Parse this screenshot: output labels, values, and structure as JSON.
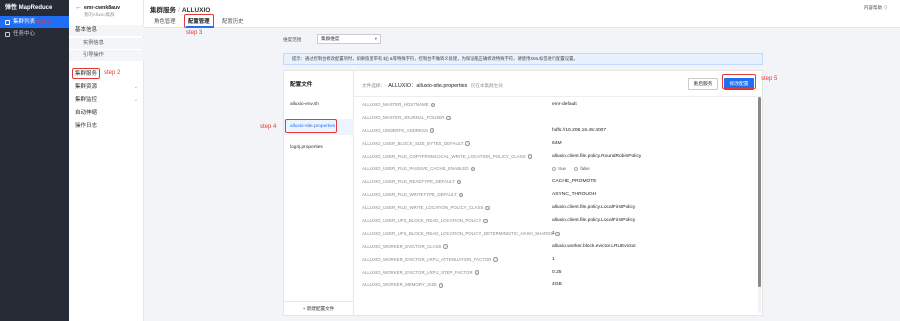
{
  "nav": {
    "brand": "弹性 MapReduce",
    "items": [
      {
        "label": "集群列表",
        "icon": "cluster-icon",
        "active": true,
        "annotation": "step 1"
      },
      {
        "label": "任务中心",
        "icon": "task-icon",
        "active": false
      }
    ]
  },
  "side": {
    "back_icon": "arrow-left-icon",
    "cluster_name": "emr-cwnk8auv",
    "cluster_desc": "我的Alluxio集群",
    "basic_info": "基本信息",
    "basic_sub": [
      "实例信息",
      "引导操作"
    ],
    "items": [
      "集群服务",
      "集群资源",
      "集群监控",
      "自动伸缩",
      "操作日志"
    ]
  },
  "header": {
    "breadcrumb_parent": "集群服务",
    "breadcrumb_sep": "/",
    "breadcrumb_current": "ALLUXIO",
    "help": "内容帮助 ⇩",
    "tabs": [
      "角色管理",
      "配置管理",
      "配置历史"
    ]
  },
  "filter": {
    "label": "维度范围",
    "value": "集群维度"
  },
  "notice": {
    "text": "提示：通过控制台修改配置项时，如果值里带有 ${} &等特殊字符，控制台不做转义处理，为保证能正确修改特殊字符，请使用XML标签进行配置设置。",
    "link": ""
  },
  "filelist": {
    "title": "配置文件",
    "files": [
      "alluxio-env.sh",
      "alluxio-site.properties",
      "log4j.properties"
    ],
    "active_index": 1,
    "add_label": "+ 新建配置文件"
  },
  "detail": {
    "file_label": "文件选择：",
    "file_name": "ALLUXIO：alluxio-site.properties",
    "file_note": "仅在本集群生效",
    "restart_label": "重启服务",
    "modify_label": "修改配置",
    "rows": [
      {
        "key": "ALLUXIO_MASTER_HOSTNAME",
        "value": "emr-default"
      },
      {
        "key": "ALLUXIO_MASTER_JOURNAL_FOLDER",
        "value": ""
      },
      {
        "key": "ALLUXIO_UNDERFS_ADDRESS",
        "value": "hdfs://10.206.16.45:4007"
      },
      {
        "key": "ALLUXIO_USER_BLOCK_SIZE_BYTES_DEFAULT",
        "value": "64M"
      },
      {
        "key": "ALLUXIO_USER_FILE_COPYFROMLOCAL_WRITE_LOCATION_POLICY_CLASS",
        "value": "alluxio.client.file.policy.RoundRobinPolicy"
      },
      {
        "key": "ALLUXIO_USER_FILE_PASSIVE_CACHE_ENABLED",
        "value": "",
        "radio": [
          "true",
          "false"
        ]
      },
      {
        "key": "ALLUXIO_USER_FILE_READTYPE_DEFAULT",
        "value": "CACHE_PROMOTE"
      },
      {
        "key": "ALLUXIO_USER_FILE_WRITETYPE_DEFAULT",
        "value": "ASYNC_THROUGH"
      },
      {
        "key": "ALLUXIO_USER_FILE_WRITE_LOCATION_POLICY_CLASS",
        "value": "alluxio.client.file.policy.LocalFirstPolicy"
      },
      {
        "key": "ALLUXIO_USER_UFS_BLOCK_READ_LOCATION_POLICY",
        "value": "alluxio.client.file.policy.LocalFirstPolicy"
      },
      {
        "key": "ALLUXIO_USER_UFS_BLOCK_READ_LOCATION_POLICY_DETERMINISTIC_HASH_SHARDS",
        "value": "1"
      },
      {
        "key": "ALLUXIO_WORKER_EVICTOR_CLASS",
        "value": "alluxio.worker.block.evictor.LRUEvictor"
      },
      {
        "key": "ALLUXIO_WORKER_EVICTOR_LRFU_ATTENUATION_FACTOR",
        "value": "1"
      },
      {
        "key": "ALLUXIO_WORKER_EVICTOR_LRFU_STEP_FACTOR",
        "value": "0.25"
      },
      {
        "key": "ALLUXIO_WORKER_MEMORY_SIZE",
        "value": "4GB"
      }
    ]
  },
  "steps": {
    "step2": "step 2",
    "step3": "step 3",
    "step4": "step 4",
    "step5": "step 5"
  },
  "colors": {
    "accent": "#1e6ff5",
    "annotation": "#e53935",
    "nav_bg": "#262b36"
  }
}
